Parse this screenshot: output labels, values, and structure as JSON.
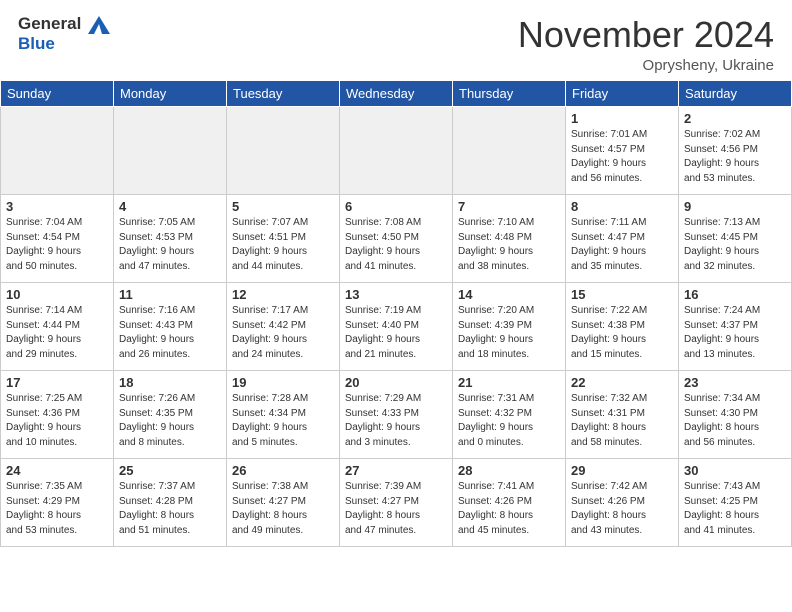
{
  "header": {
    "logo_line1": "General",
    "logo_line2": "Blue",
    "month": "November 2024",
    "location": "Oprysheny, Ukraine"
  },
  "weekdays": [
    "Sunday",
    "Monday",
    "Tuesday",
    "Wednesday",
    "Thursday",
    "Friday",
    "Saturday"
  ],
  "weeks": [
    [
      {
        "day": "",
        "info": "",
        "empty": true
      },
      {
        "day": "",
        "info": "",
        "empty": true
      },
      {
        "day": "",
        "info": "",
        "empty": true
      },
      {
        "day": "",
        "info": "",
        "empty": true
      },
      {
        "day": "",
        "info": "",
        "empty": true
      },
      {
        "day": "1",
        "info": "Sunrise: 7:01 AM\nSunset: 4:57 PM\nDaylight: 9 hours\nand 56 minutes.",
        "empty": false
      },
      {
        "day": "2",
        "info": "Sunrise: 7:02 AM\nSunset: 4:56 PM\nDaylight: 9 hours\nand 53 minutes.",
        "empty": false
      }
    ],
    [
      {
        "day": "3",
        "info": "Sunrise: 7:04 AM\nSunset: 4:54 PM\nDaylight: 9 hours\nand 50 minutes.",
        "empty": false
      },
      {
        "day": "4",
        "info": "Sunrise: 7:05 AM\nSunset: 4:53 PM\nDaylight: 9 hours\nand 47 minutes.",
        "empty": false
      },
      {
        "day": "5",
        "info": "Sunrise: 7:07 AM\nSunset: 4:51 PM\nDaylight: 9 hours\nand 44 minutes.",
        "empty": false
      },
      {
        "day": "6",
        "info": "Sunrise: 7:08 AM\nSunset: 4:50 PM\nDaylight: 9 hours\nand 41 minutes.",
        "empty": false
      },
      {
        "day": "7",
        "info": "Sunrise: 7:10 AM\nSunset: 4:48 PM\nDaylight: 9 hours\nand 38 minutes.",
        "empty": false
      },
      {
        "day": "8",
        "info": "Sunrise: 7:11 AM\nSunset: 4:47 PM\nDaylight: 9 hours\nand 35 minutes.",
        "empty": false
      },
      {
        "day": "9",
        "info": "Sunrise: 7:13 AM\nSunset: 4:45 PM\nDaylight: 9 hours\nand 32 minutes.",
        "empty": false
      }
    ],
    [
      {
        "day": "10",
        "info": "Sunrise: 7:14 AM\nSunset: 4:44 PM\nDaylight: 9 hours\nand 29 minutes.",
        "empty": false
      },
      {
        "day": "11",
        "info": "Sunrise: 7:16 AM\nSunset: 4:43 PM\nDaylight: 9 hours\nand 26 minutes.",
        "empty": false
      },
      {
        "day": "12",
        "info": "Sunrise: 7:17 AM\nSunset: 4:42 PM\nDaylight: 9 hours\nand 24 minutes.",
        "empty": false
      },
      {
        "day": "13",
        "info": "Sunrise: 7:19 AM\nSunset: 4:40 PM\nDaylight: 9 hours\nand 21 minutes.",
        "empty": false
      },
      {
        "day": "14",
        "info": "Sunrise: 7:20 AM\nSunset: 4:39 PM\nDaylight: 9 hours\nand 18 minutes.",
        "empty": false
      },
      {
        "day": "15",
        "info": "Sunrise: 7:22 AM\nSunset: 4:38 PM\nDaylight: 9 hours\nand 15 minutes.",
        "empty": false
      },
      {
        "day": "16",
        "info": "Sunrise: 7:24 AM\nSunset: 4:37 PM\nDaylight: 9 hours\nand 13 minutes.",
        "empty": false
      }
    ],
    [
      {
        "day": "17",
        "info": "Sunrise: 7:25 AM\nSunset: 4:36 PM\nDaylight: 9 hours\nand 10 minutes.",
        "empty": false
      },
      {
        "day": "18",
        "info": "Sunrise: 7:26 AM\nSunset: 4:35 PM\nDaylight: 9 hours\nand 8 minutes.",
        "empty": false
      },
      {
        "day": "19",
        "info": "Sunrise: 7:28 AM\nSunset: 4:34 PM\nDaylight: 9 hours\nand 5 minutes.",
        "empty": false
      },
      {
        "day": "20",
        "info": "Sunrise: 7:29 AM\nSunset: 4:33 PM\nDaylight: 9 hours\nand 3 minutes.",
        "empty": false
      },
      {
        "day": "21",
        "info": "Sunrise: 7:31 AM\nSunset: 4:32 PM\nDaylight: 9 hours\nand 0 minutes.",
        "empty": false
      },
      {
        "day": "22",
        "info": "Sunrise: 7:32 AM\nSunset: 4:31 PM\nDaylight: 8 hours\nand 58 minutes.",
        "empty": false
      },
      {
        "day": "23",
        "info": "Sunrise: 7:34 AM\nSunset: 4:30 PM\nDaylight: 8 hours\nand 56 minutes.",
        "empty": false
      }
    ],
    [
      {
        "day": "24",
        "info": "Sunrise: 7:35 AM\nSunset: 4:29 PM\nDaylight: 8 hours\nand 53 minutes.",
        "empty": false
      },
      {
        "day": "25",
        "info": "Sunrise: 7:37 AM\nSunset: 4:28 PM\nDaylight: 8 hours\nand 51 minutes.",
        "empty": false
      },
      {
        "day": "26",
        "info": "Sunrise: 7:38 AM\nSunset: 4:27 PM\nDaylight: 8 hours\nand 49 minutes.",
        "empty": false
      },
      {
        "day": "27",
        "info": "Sunrise: 7:39 AM\nSunset: 4:27 PM\nDaylight: 8 hours\nand 47 minutes.",
        "empty": false
      },
      {
        "day": "28",
        "info": "Sunrise: 7:41 AM\nSunset: 4:26 PM\nDaylight: 8 hours\nand 45 minutes.",
        "empty": false
      },
      {
        "day": "29",
        "info": "Sunrise: 7:42 AM\nSunset: 4:26 PM\nDaylight: 8 hours\nand 43 minutes.",
        "empty": false
      },
      {
        "day": "30",
        "info": "Sunrise: 7:43 AM\nSunset: 4:25 PM\nDaylight: 8 hours\nand 41 minutes.",
        "empty": false
      }
    ]
  ]
}
